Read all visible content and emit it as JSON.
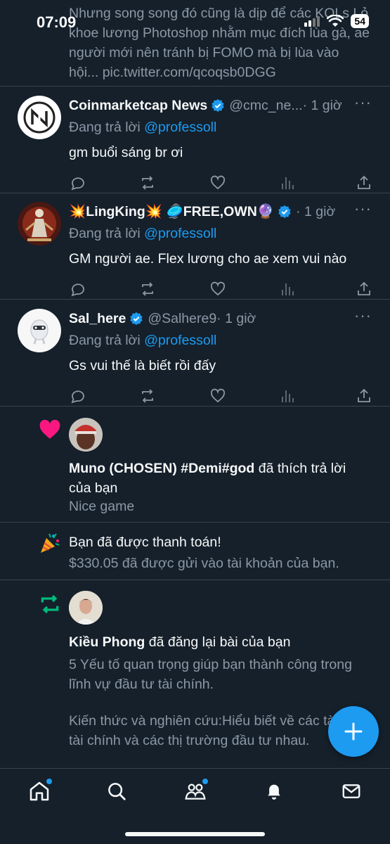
{
  "status": {
    "time": "07:09",
    "battery": "54"
  },
  "top_tweet": {
    "text": "Nhưng song song đó cũng là dịp để các KOLs Lỏ khoe lương Photoshop  nhằm mục đích lùa gà, ae người mới nên tránh bị FOMO mà bị lùa vào hội... pic.twitter.com/qcoqsb0DGG"
  },
  "replies": [
    {
      "name": "Coinmarketcap News",
      "handle": "@cmc_ne...",
      "time": "· 1 giờ",
      "replying_prefix": "Đang trả lời",
      "mention": "@professoll",
      "body": "gm buổi sáng br ơi",
      "avatar": "coinmarketcap-logo"
    },
    {
      "name": "💥LingKing💥 🥏FREE,OWN🔮",
      "handle": "",
      "time": "· 1 giờ",
      "replying_prefix": "Đang trả lời",
      "mention": "@professoll",
      "body": "GM người ae. Flex lương cho ae xem vui nào",
      "avatar": "golden-figure"
    },
    {
      "name": "Sal_here",
      "handle": "@Salhere9",
      "time": "· 1 giờ",
      "replying_prefix": "Đang trả lời",
      "mention": "@professoll",
      "body": "Gs vui thế là biết rồi đấy",
      "avatar": "white-character"
    }
  ],
  "notifications": {
    "like": {
      "user": "Muno (CHOSEN) #Demi#god",
      "action": "đã thích trả lời của bạn",
      "detail": "Nice game",
      "icon": "heart-icon"
    },
    "payment": {
      "title": "Bạn đã được thanh toán!",
      "detail": "$330.05 đã được gửi vào tài khoản của bạn.",
      "icon": "party-popper-icon"
    },
    "repost": {
      "user": "Kiều Phong",
      "action": "đã đăng lại bài của bạn",
      "line1": "5 Yếu tố quan trọng giúp bạn thành công trong lĩnh vự đầu tư tài chính.",
      "line2": "Kiến thức và nghiên cứu:Hiểu biết về các tài sản tài chính và các thị trường đầu tư nhau.",
      "icon": "repost-icon"
    }
  },
  "colors": {
    "background": "#15202b",
    "accent": "#1d9bf0",
    "muted": "#8b98a5",
    "like": "#f91880",
    "repost": "#00ba7c"
  }
}
